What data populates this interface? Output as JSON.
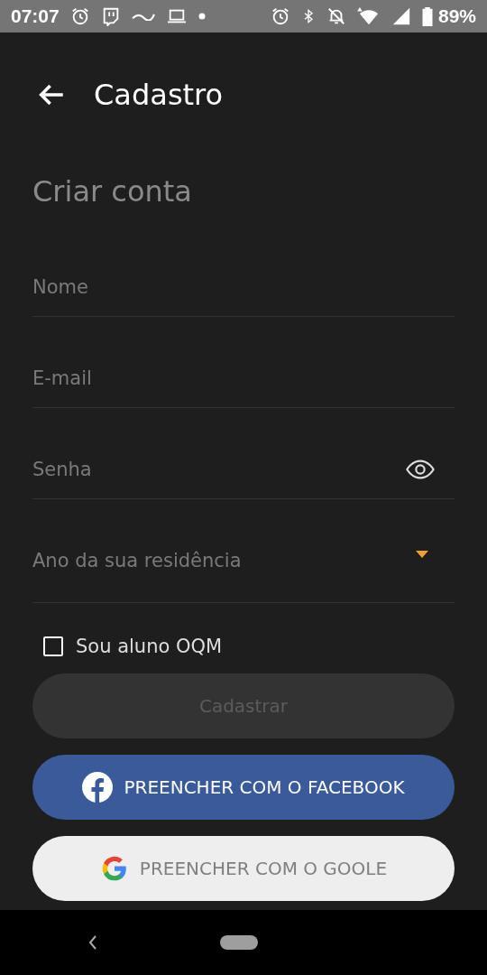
{
  "status_bar": {
    "time": "07:07",
    "battery": "89%"
  },
  "header": {
    "title": "Cadastro"
  },
  "heading": "Criar conta",
  "fields": [
    {
      "kind": "text",
      "placeholder": "Nome"
    },
    {
      "kind": "text",
      "placeholder": "E-mail"
    },
    {
      "kind": "password",
      "placeholder": "Senha"
    },
    {
      "kind": "select",
      "placeholder": "Ano da sua residência"
    }
  ],
  "checkbox": {
    "label": "Sou aluno OQM",
    "checked": false
  },
  "buttons": [
    {
      "kind": "submit",
      "label": "Cadastrar",
      "disabled": true
    },
    {
      "kind": "facebook",
      "label": "PREENCHER COM O FACEBOOK"
    },
    {
      "kind": "google",
      "label": "PREENCHER COM O GOOLE"
    }
  ]
}
